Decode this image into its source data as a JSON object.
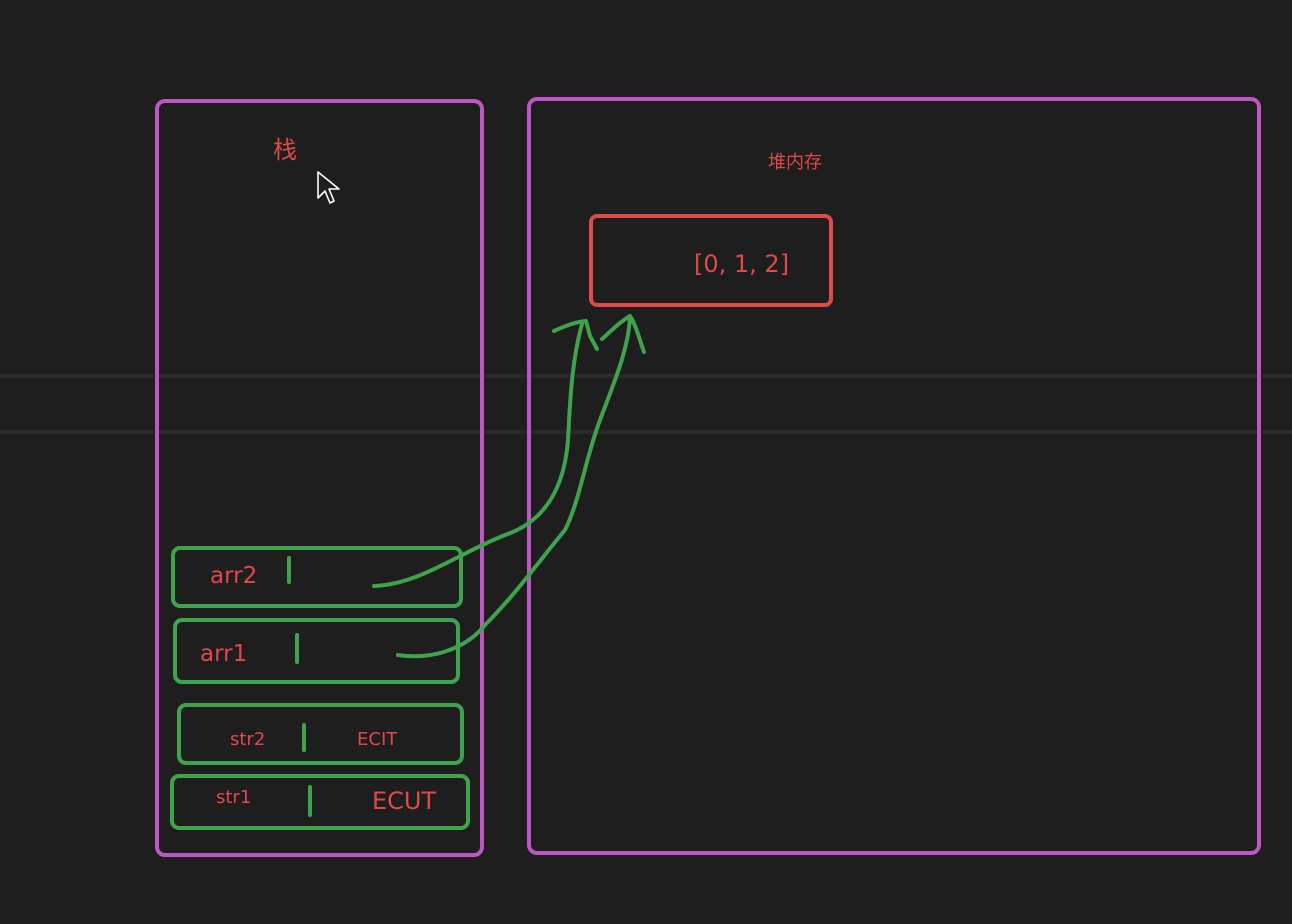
{
  "stack": {
    "title": "栈",
    "slots": [
      {
        "name": "arr2",
        "value": ""
      },
      {
        "name": "arr1",
        "value": ""
      },
      {
        "name": "str2",
        "value": "ECIT"
      },
      {
        "name": "str1",
        "value": "ECUT"
      }
    ]
  },
  "heap": {
    "title": "堆内存",
    "object_value": "[0, 1, 2]"
  },
  "colors": {
    "background": "#1e1e1f",
    "region_border": "#c055c4",
    "slot_border": "#3fa34d",
    "object_border": "#e0484a",
    "text": "#e0484a",
    "arrow": "#3fa34d"
  },
  "icons": [
    "mouse-cursor-icon"
  ]
}
